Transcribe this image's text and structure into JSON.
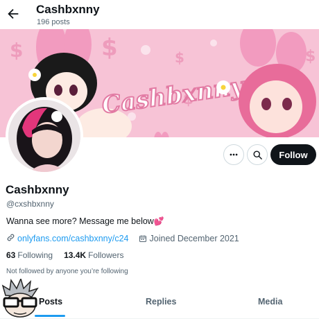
{
  "header": {
    "back_icon": "arrow-left-icon",
    "name": "Cashbxnny",
    "post_count": "196 posts"
  },
  "banner": {
    "wordmark": "Cashbxnny",
    "colors": {
      "background": "#f7c3d6",
      "accent": "#e27aa3",
      "light": "#fbe3ec"
    }
  },
  "profile": {
    "display_name": "Cashbxnny",
    "handle": "@cxshbxnny",
    "bio": "Wanna see more? Message me below",
    "bio_emoji": "💕",
    "link_icon": "link-icon",
    "link": "onlyfans.com/cashbxnny/c24",
    "calendar_icon": "calendar-icon",
    "joined": "Joined December 2021",
    "following_count": "63",
    "following_label": "Following",
    "followers_count": "13.4K",
    "followers_label": "Followers",
    "not_followed_text": "Not followed by anyone you’re following"
  },
  "actions": {
    "more_icon": "more-dots-icon",
    "search_icon": "search-icon",
    "follow_label": "Follow"
  },
  "tabs": [
    {
      "label": "Posts",
      "active": true
    },
    {
      "label": "Replies",
      "active": false
    },
    {
      "label": "Media",
      "active": false
    }
  ],
  "colors": {
    "link": "#1d9bf0",
    "text": "#0f1419",
    "secondary": "#536471",
    "follow_bg": "#0f1419"
  }
}
